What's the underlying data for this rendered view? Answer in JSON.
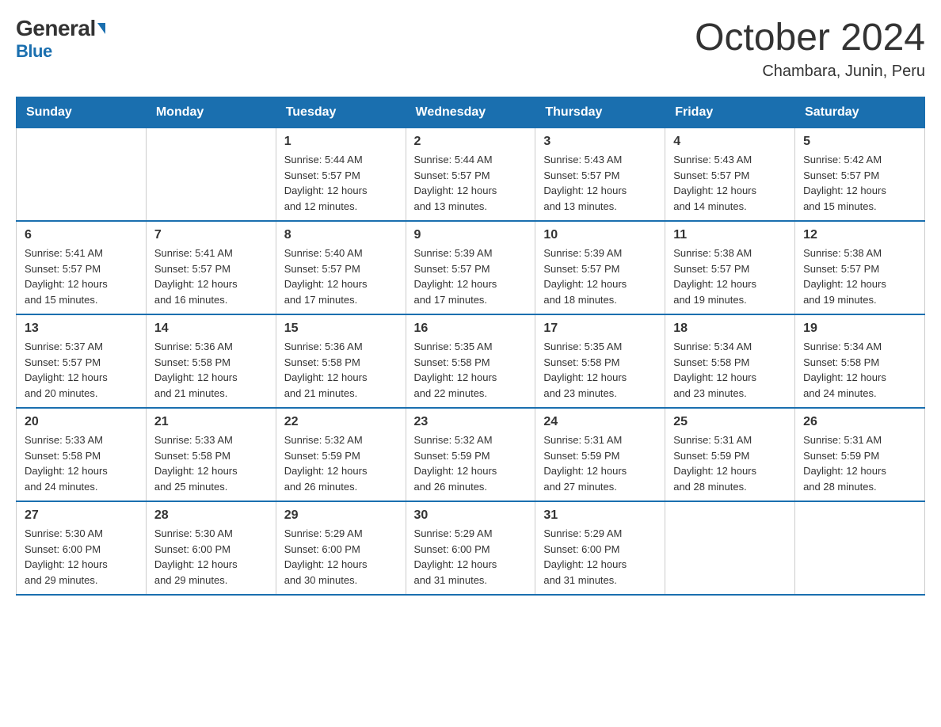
{
  "logo": {
    "general": "General",
    "blue": "Blue",
    "alt": "GeneralBlue logo"
  },
  "header": {
    "month_year": "October 2024",
    "location": "Chambara, Junin, Peru"
  },
  "weekdays": [
    "Sunday",
    "Monday",
    "Tuesday",
    "Wednesday",
    "Thursday",
    "Friday",
    "Saturday"
  ],
  "weeks": [
    [
      {
        "day": "",
        "info": ""
      },
      {
        "day": "",
        "info": ""
      },
      {
        "day": "1",
        "info": "Sunrise: 5:44 AM\nSunset: 5:57 PM\nDaylight: 12 hours\nand 12 minutes."
      },
      {
        "day": "2",
        "info": "Sunrise: 5:44 AM\nSunset: 5:57 PM\nDaylight: 12 hours\nand 13 minutes."
      },
      {
        "day": "3",
        "info": "Sunrise: 5:43 AM\nSunset: 5:57 PM\nDaylight: 12 hours\nand 13 minutes."
      },
      {
        "day": "4",
        "info": "Sunrise: 5:43 AM\nSunset: 5:57 PM\nDaylight: 12 hours\nand 14 minutes."
      },
      {
        "day": "5",
        "info": "Sunrise: 5:42 AM\nSunset: 5:57 PM\nDaylight: 12 hours\nand 15 minutes."
      }
    ],
    [
      {
        "day": "6",
        "info": "Sunrise: 5:41 AM\nSunset: 5:57 PM\nDaylight: 12 hours\nand 15 minutes."
      },
      {
        "day": "7",
        "info": "Sunrise: 5:41 AM\nSunset: 5:57 PM\nDaylight: 12 hours\nand 16 minutes."
      },
      {
        "day": "8",
        "info": "Sunrise: 5:40 AM\nSunset: 5:57 PM\nDaylight: 12 hours\nand 17 minutes."
      },
      {
        "day": "9",
        "info": "Sunrise: 5:39 AM\nSunset: 5:57 PM\nDaylight: 12 hours\nand 17 minutes."
      },
      {
        "day": "10",
        "info": "Sunrise: 5:39 AM\nSunset: 5:57 PM\nDaylight: 12 hours\nand 18 minutes."
      },
      {
        "day": "11",
        "info": "Sunrise: 5:38 AM\nSunset: 5:57 PM\nDaylight: 12 hours\nand 19 minutes."
      },
      {
        "day": "12",
        "info": "Sunrise: 5:38 AM\nSunset: 5:57 PM\nDaylight: 12 hours\nand 19 minutes."
      }
    ],
    [
      {
        "day": "13",
        "info": "Sunrise: 5:37 AM\nSunset: 5:57 PM\nDaylight: 12 hours\nand 20 minutes."
      },
      {
        "day": "14",
        "info": "Sunrise: 5:36 AM\nSunset: 5:58 PM\nDaylight: 12 hours\nand 21 minutes."
      },
      {
        "day": "15",
        "info": "Sunrise: 5:36 AM\nSunset: 5:58 PM\nDaylight: 12 hours\nand 21 minutes."
      },
      {
        "day": "16",
        "info": "Sunrise: 5:35 AM\nSunset: 5:58 PM\nDaylight: 12 hours\nand 22 minutes."
      },
      {
        "day": "17",
        "info": "Sunrise: 5:35 AM\nSunset: 5:58 PM\nDaylight: 12 hours\nand 23 minutes."
      },
      {
        "day": "18",
        "info": "Sunrise: 5:34 AM\nSunset: 5:58 PM\nDaylight: 12 hours\nand 23 minutes."
      },
      {
        "day": "19",
        "info": "Sunrise: 5:34 AM\nSunset: 5:58 PM\nDaylight: 12 hours\nand 24 minutes."
      }
    ],
    [
      {
        "day": "20",
        "info": "Sunrise: 5:33 AM\nSunset: 5:58 PM\nDaylight: 12 hours\nand 24 minutes."
      },
      {
        "day": "21",
        "info": "Sunrise: 5:33 AM\nSunset: 5:58 PM\nDaylight: 12 hours\nand 25 minutes."
      },
      {
        "day": "22",
        "info": "Sunrise: 5:32 AM\nSunset: 5:59 PM\nDaylight: 12 hours\nand 26 minutes."
      },
      {
        "day": "23",
        "info": "Sunrise: 5:32 AM\nSunset: 5:59 PM\nDaylight: 12 hours\nand 26 minutes."
      },
      {
        "day": "24",
        "info": "Sunrise: 5:31 AM\nSunset: 5:59 PM\nDaylight: 12 hours\nand 27 minutes."
      },
      {
        "day": "25",
        "info": "Sunrise: 5:31 AM\nSunset: 5:59 PM\nDaylight: 12 hours\nand 28 minutes."
      },
      {
        "day": "26",
        "info": "Sunrise: 5:31 AM\nSunset: 5:59 PM\nDaylight: 12 hours\nand 28 minutes."
      }
    ],
    [
      {
        "day": "27",
        "info": "Sunrise: 5:30 AM\nSunset: 6:00 PM\nDaylight: 12 hours\nand 29 minutes."
      },
      {
        "day": "28",
        "info": "Sunrise: 5:30 AM\nSunset: 6:00 PM\nDaylight: 12 hours\nand 29 minutes."
      },
      {
        "day": "29",
        "info": "Sunrise: 5:29 AM\nSunset: 6:00 PM\nDaylight: 12 hours\nand 30 minutes."
      },
      {
        "day": "30",
        "info": "Sunrise: 5:29 AM\nSunset: 6:00 PM\nDaylight: 12 hours\nand 31 minutes."
      },
      {
        "day": "31",
        "info": "Sunrise: 5:29 AM\nSunset: 6:00 PM\nDaylight: 12 hours\nand 31 minutes."
      },
      {
        "day": "",
        "info": ""
      },
      {
        "day": "",
        "info": ""
      }
    ]
  ]
}
